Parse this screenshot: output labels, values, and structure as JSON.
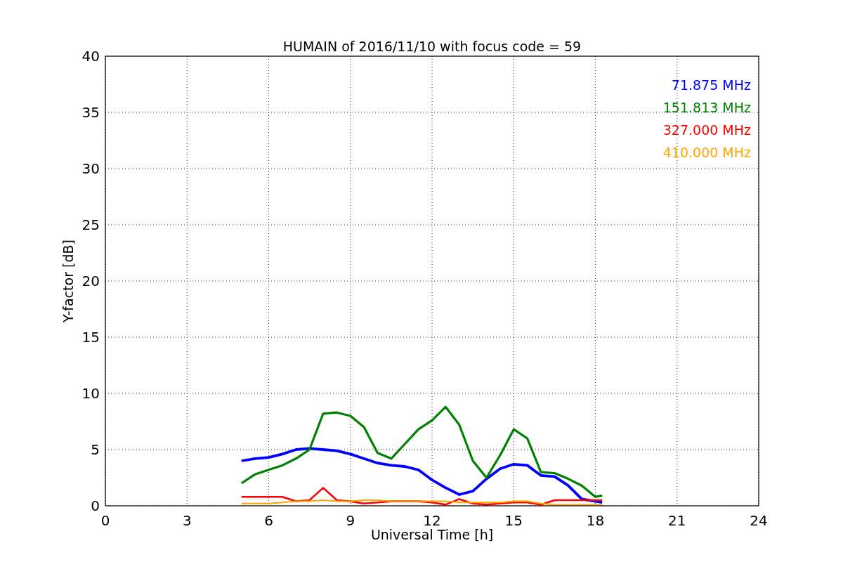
{
  "figure": {
    "chart_data": {
      "type": "line",
      "title": "HUMAIN of 2016/11/10 with focus code = 59",
      "xlabel": "Universal Time [h]",
      "ylabel": "Y-factor [dB]",
      "x": [
        5,
        5.5,
        6,
        6.5,
        7,
        7.5,
        8,
        8.5,
        9,
        9.5,
        10,
        10.5,
        11,
        11.5,
        12,
        12.5,
        13,
        13.5,
        14,
        14.5,
        15,
        15.5,
        16,
        16.5,
        17,
        17.5,
        18,
        18.25
      ],
      "series": [
        {
          "name": "71.875 MHz",
          "color": "#0000ff",
          "values": [
            4.0,
            4.2,
            4.3,
            4.6,
            5.0,
            5.1,
            5.0,
            4.9,
            4.6,
            4.2,
            3.8,
            3.6,
            3.5,
            3.2,
            2.3,
            1.6,
            1.0,
            1.3,
            2.4,
            3.3,
            3.7,
            3.6,
            2.7,
            2.6,
            1.8,
            0.6,
            0.4,
            0.3
          ]
        },
        {
          "name": "151.813 MHz",
          "color": "#008000",
          "values": [
            2.0,
            2.8,
            3.2,
            3.6,
            4.2,
            5.0,
            8.2,
            8.3,
            8.0,
            7.0,
            4.7,
            4.2,
            5.5,
            6.8,
            7.6,
            8.8,
            7.2,
            4.0,
            2.5,
            4.5,
            6.8,
            6.0,
            3.0,
            2.9,
            2.4,
            1.8,
            0.8,
            0.9
          ]
        },
        {
          "name": "327.000 MHz",
          "color": "#ff0000",
          "values": [
            0.8,
            0.8,
            0.8,
            0.8,
            0.4,
            0.5,
            1.6,
            0.5,
            0.4,
            0.2,
            0.3,
            0.4,
            0.4,
            0.4,
            0.3,
            0.1,
            0.6,
            0.2,
            0.1,
            0.2,
            0.3,
            0.3,
            0.1,
            0.5,
            0.5,
            0.5,
            0.5,
            0.5
          ]
        },
        {
          "name": "410.000 MHz",
          "color": "#ffa500",
          "values": [
            0.2,
            0.2,
            0.2,
            0.3,
            0.4,
            0.4,
            0.5,
            0.4,
            0.4,
            0.5,
            0.5,
            0.4,
            0.4,
            0.4,
            0.4,
            0.4,
            0.3,
            0.3,
            0.3,
            0.3,
            0.4,
            0.4,
            0.2,
            0.1,
            0.1,
            0.1,
            0.1,
            0.1
          ]
        }
      ],
      "xlim": [
        0,
        24
      ],
      "ylim": [
        0,
        40
      ],
      "xticks": [
        0,
        3,
        6,
        9,
        12,
        15,
        18,
        21,
        24
      ],
      "yticks": [
        0,
        5,
        10,
        15,
        20,
        25,
        30,
        35,
        40
      ],
      "grid": true
    }
  }
}
